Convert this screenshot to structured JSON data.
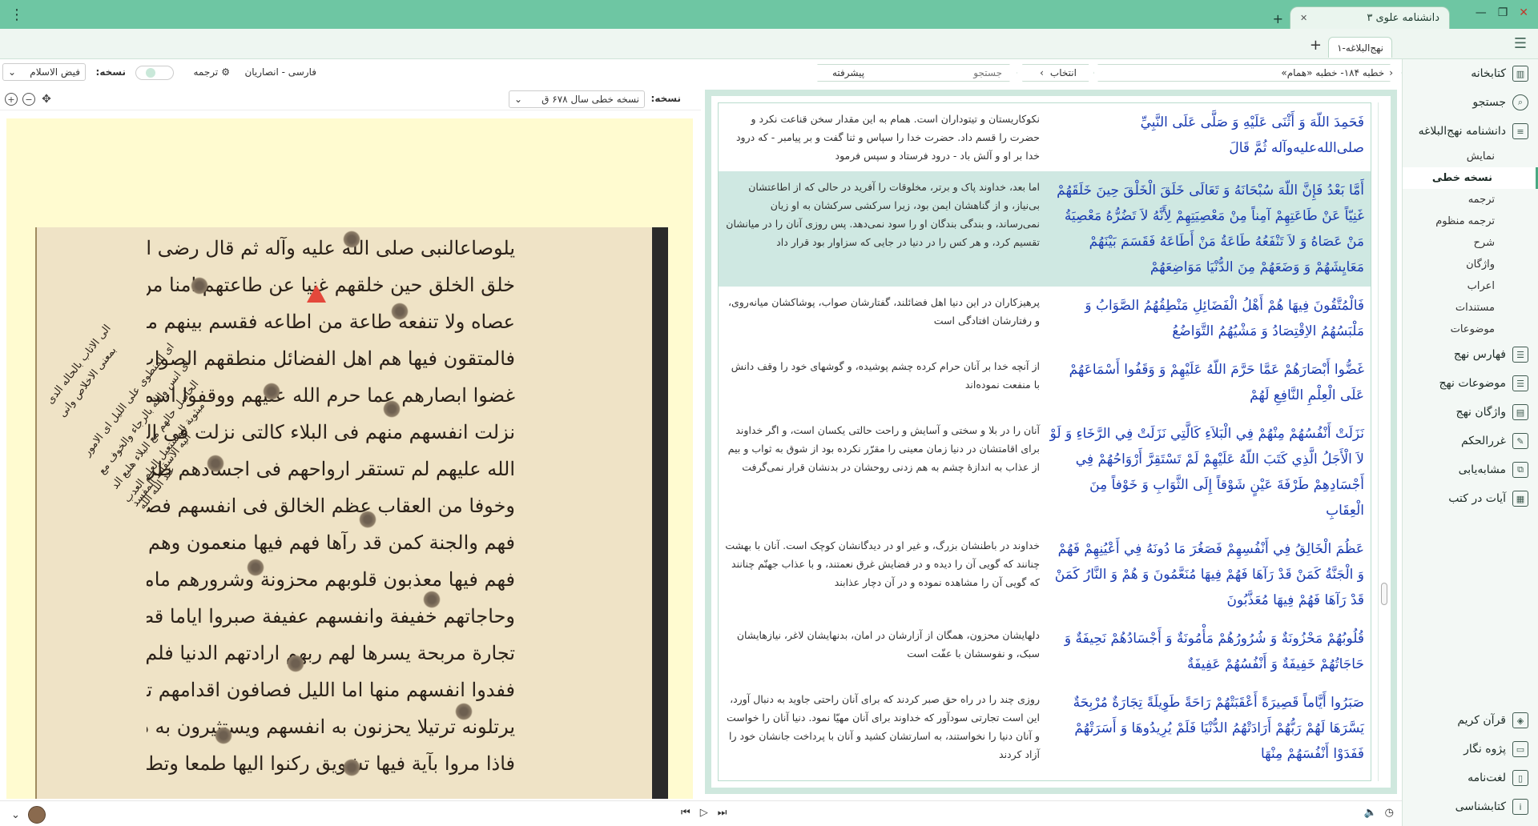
{
  "window": {
    "app_tab_title": "دانشنامه علوی ۳",
    "menu_icon": "vertical-dots-icon",
    "controls": [
      "—",
      "❐",
      "✕"
    ]
  },
  "doc_tab": {
    "title": "نهج‌البلاغه-۱"
  },
  "sidebar": {
    "items": [
      {
        "label": "کتابخانه",
        "icon": "library-icon"
      },
      {
        "label": "جستجو",
        "icon": "search-icon"
      },
      {
        "label": "دانشنامه نهج‌البلاغه",
        "icon": "encyclopedia-icon"
      }
    ],
    "subitems": [
      {
        "label": "نمایش",
        "active": false
      },
      {
        "label": "نسخه خطی",
        "active": true
      },
      {
        "label": "ترجمه",
        "active": false
      },
      {
        "label": "ترجمه منظوم",
        "active": false
      },
      {
        "label": "شرح",
        "active": false
      },
      {
        "label": "واژگان",
        "active": false
      },
      {
        "label": "اعراب",
        "active": false
      },
      {
        "label": "مستندات",
        "active": false
      },
      {
        "label": "موضوعات",
        "active": false
      }
    ],
    "tools": [
      {
        "label": "فهارس نهج",
        "icon": "index-icon"
      },
      {
        "label": "موضوعات نهج",
        "icon": "topics-icon"
      },
      {
        "label": "واژگان نهج",
        "icon": "words-icon"
      },
      {
        "label": "غررالحکم",
        "icon": "ghurar-icon"
      },
      {
        "label": "مشابه‌یابی",
        "icon": "similarity-icon"
      },
      {
        "label": "آیات در کتب",
        "icon": "verses-icon"
      }
    ],
    "bottom": [
      {
        "label": "قرآن کریم",
        "icon": "quran-icon"
      },
      {
        "label": "پژوه نگار",
        "icon": "notes-icon"
      },
      {
        "label": "لغت‌نامه",
        "icon": "dictionary-icon"
      },
      {
        "label": "کتابشناسی",
        "icon": "info-icon"
      }
    ]
  },
  "toolbar": {
    "breadcrumb": "خطبه ۱۸۴- خطبه «همام»",
    "select_label": "انتخاب",
    "search_placeholder": "جستجو",
    "advanced": "پیشرفته"
  },
  "left_toolbar": {
    "edition_label": "نسخه:",
    "edition_value": "فیض الاسلام",
    "translation_label": "ترجمه",
    "language": "فارسی - انصاریان"
  },
  "manuscript": {
    "label": "نسخه:",
    "value": "نسخه خطی سال ۶۷۸ ق",
    "lines": [
      "یلوصاعالنبی صلی الله علیه وآله ثم قال رضی الله عنه امابعد فان الله تعالی",
      "خلق الخلق حین خلقهم غنیا عن طاعتهم امنا من معصیتهم لانه لا تضره معصیة من",
      "عصاه ولا تنفعه طاعة من اطاعه فقسم بینهم معایشهم ووضعهم من الدنیا مواضعهم",
      "فالمتقون فیها هم اهل الفضائل منطقهم الصواب وملبسهم الاقتصاد ومشیهم التواضع",
      "غضوا ابصارهم عما حرم الله علیهم ووقفوا اسماعهم علی العلم النافع لهم",
      "نزلت انفسهم منهم فی البلاء کالتی نزلت فی الرخاء ولولا الاجل الذی کتب",
      "الله علیهم لم تستقر ارواحهم فی اجسادهم طرفة عین شوقا الی الثواب",
      "وخوفا من العقاب عظم الخالق فی انفسهم فصغر ما دونه فی اعینهم",
      "فهم والجنة کمن قد رآها فهم فیها منعمون وهم والنار کمن قد رآها",
      "فهم فیها معذبون قلوبهم محزونة وشرورهم مامونة واجسادهم نحیفة",
      "وحاجاتهم خفیفة وانفسهم عفیفة صبروا ایاما قصیرة اعقبتهم راحة طویلة",
      "تجارة مربحة یسرها لهم ربهم ارادتهم الدنیا فلم یریدوها واسرتهم",
      "ففدوا انفسهم منها اما اللیل فصافون اقدامهم تالین لاجزاء القرآن",
      "یرتلونه ترتیلا یحزنون به انفسهم ویستثیرون به دواء دائهم",
      "فاذا مروا بآیة فیها تشویق رکنوا الیها طمعا وتطلعت نفوسهم الیها"
    ],
    "margin_note": [
      "الی الاتاب بالحاله الدی",
      "بمعنی الاخلاص وانی",
      "ای المنطوی علی اللیل ای الامور",
      "ای انس والله بالرجاء والخوف مع",
      "الحاصل حالهم مع البلاء هلبع الد",
      "مبثوبة المستعیل العلم العدب",
      "الیه الاسقاط المفسد",
      "عند الله الله"
    ]
  },
  "verses": [
    {
      "ar": "فَحَمِدَ اللّهَ وَ أَثْنَى عَلَيْهِ وَ صَلَّى عَلَى النَّبِيِّ صلى‌الله‌عليه‌وآله ثُمَّ قَالَ",
      "fa": "نکوکاریستان و تیتوداران است. همام به این مقدار سخن قناعت نکرد و حضرت را قسم داد. حضرت خدا را سپاس و ثنا گفت و بر پیامبر - که درود خدا بر او و آلش باد - درود فرستاد و سپس فرمود",
      "highlight": false
    },
    {
      "ar": "أَمَّا بَعْدُ فَإِنَّ اللّهَ سُبْحَانَهُ وَ تَعَالَى خَلَقَ الْخَلْقَ حِينَ خَلَقَهُمْ غَنِيّاً عَنْ طَاعَتِهِمْ آمِناً مِنْ مَعْصِيَتِهِمْ لِأَنَّهُ لاَ تَضُرُّهُ مَعْصِيَةُ مَنْ عَصَاهُ وَ لاَ تَنْفَعُهُ طَاعَةُ مَنْ أَطَاعَهُ فَقَسَمَ بَيْنَهُمْ مَعَايِشَهُمْ وَ وَضَعَهُمْ مِنَ الدُّنْيَا مَوَاضِعَهُمْ",
      "fa": "اما بعد، خداوند پاک و برتر، مخلوقات را آفرید در حالی که از اطاعتشان بی‌نیاز، و از گناهشان ایمن بود، زیرا سرکشی سرکشان به او زیان نمی‌رساند، و بندگی بندگان او را سود نمی‌دهد. پس روزی آنان را در میانشان تقسیم کرد، و هر کس را در دنیا در جایی که سزاوار بود قرار داد",
      "highlight": true
    },
    {
      "ar": "فَالْمُتَّقُونَ فِيهَا هُمْ أَهْلُ الْفَضَائِلِ مَنْطِقُهُمُ الصَّوَابُ وَ مَلْبَسُهُمُ الاِقْتِصَادُ وَ مَشْيُهُمُ التَّوَاضُعُ",
      "fa": "پرهیزکاران در این دنیا اهل فضائلند، گفتارشان صواب، پوشاکشان میانه‌روی، و رفتارشان افتادگی است",
      "highlight": false
    },
    {
      "ar": "غَضُّوا أَبْصَارَهُمْ عَمَّا حَرَّمَ اللّهُ عَلَيْهِمْ وَ وَقَفُوا أَسْمَاعَهُمْ عَلَى الْعِلْمِ النَّافِعِ لَهُمْ",
      "fa": "از آنچه خدا بر آنان حرام کرده چشم پوشیده، و گوشهای خود را وقف دانش با منفعت نموده‌اند",
      "highlight": false
    },
    {
      "ar": "نَزَلَتْ أَنْفُسُهُمْ مِنْهُمْ فِي الْبَلاَءِ كَالَّتِي نَزَلَتْ فِي الرَّخَاءِ وَ لَوْ لاَ الْأَجَلُ الَّذِي كَتَبَ اللّهُ عَلَيْهِمْ لَمْ تَسْتَقِرَّ أَرْوَاحُهُمْ فِي أَجْسَادِهِمْ طَرْفَةَ عَيْنٍ شَوْقاً إِلَى الثَّوَابِ وَ خَوْفاً مِنَ الْعِقَابِ",
      "fa": "آنان را در بلا و سختی و آسایش و راحت حالتی یکسان است، و اگر خداوند برای اقامتشان در دنیا زمان معینی را مقرّر نکرده بود از شوق به ثواب و بیم از عذاب به اندازۀ چشم به هم زدنی روحشان در بدنشان قرار نمی‌گرفت",
      "highlight": false
    },
    {
      "ar": "عَظُمَ الْخَالِقُ فِي أَنْفُسِهِمْ فَصَغُرَ مَا دُونَهُ فِي أَعْيُنِهِمْ فَهُمْ وَ الْجَنَّةُ كَمَنْ قَدْ رَآهَا فَهُمْ فِيهَا مُنَعَّمُونَ وَ هُمْ وَ النَّارُ كَمَنْ قَدْ رَآهَا فَهُمْ فِيهَا مُعَذَّبُونَ",
      "fa": "خداوند در باطنشان بزرگ، و غیر او در دیدگانشان کوچک است. آنان با بهشت چنانند که گویی آن را دیده و در فضایش غرق نعمتند، و با عذاب جهنّم چنانند که گویی آن را مشاهده نموده و در آن دچار عذابند",
      "highlight": false
    },
    {
      "ar": "قُلُوبُهُمْ مَحْزُونَةٌ وَ شُرُورُهُمْ مَأْمُونَةٌ وَ أَجْسَادُهُمْ نَحِيفَةٌ وَ حَاجَاتُهُمْ خَفِيفَةٌ وَ أَنْفُسُهُمْ عَفِيفَةٌ",
      "fa": "دلهایشان محزون، همگان از آزارشان در امان، بدنهایشان لاغر، نیازهایشان سبک، و نفوسشان با عفّت است",
      "highlight": false
    },
    {
      "ar": "صَبَرُوا أَيَّاماً قَصِيرَةً أَعْقَبَتْهُمْ رَاحَةً طَوِيلَةً تِجَارَةٌ مُرْبِحَةٌ يَسَّرَهَا لَهُمْ رَبُّهُمْ أَرَادَتْهُمُ الدُّنْيَا فَلَمْ يُرِيدُوهَا وَ أَسَرَتْهُمْ فَفَدَوْا أَنْفُسَهُمْ مِنْهَا",
      "fa": "روزی چند را در راه حق صبر کردند که برای آنان راحتی جاوید به دنبال آورد، این است تجارتی سودآور که خداوند برای آنان مهیّا نمود. دنیا آنان را خواست و آنان دنیا را نخواستند، به اسارتشان کشید و آنان با پرداخت جانشان خود را آزاد کردند",
      "highlight": false
    }
  ],
  "bottombar": {
    "media": [
      "⏮",
      "▷",
      "⏭"
    ],
    "audio": [
      "🔈",
      "◷"
    ]
  }
}
